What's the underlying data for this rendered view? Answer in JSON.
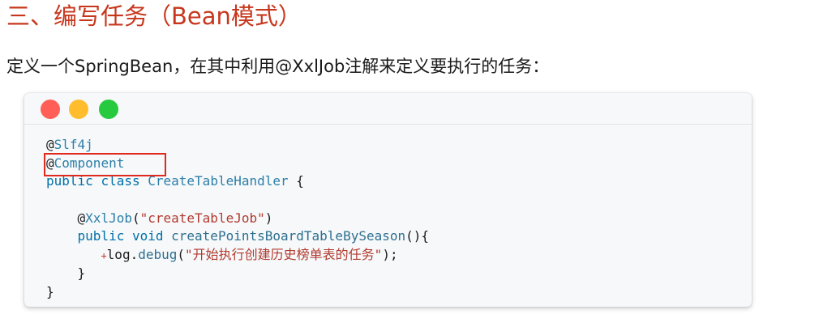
{
  "heading": "三、编写任务（Bean模式）",
  "intro": "定义一个SpringBean，在其中利用@XxlJob注解来定义要执行的任务：",
  "colors": {
    "heading": "#c7371d",
    "highlight_box": "#e02a1e",
    "window_red": "#ff5f56",
    "window_yellow": "#ffbd2e",
    "window_green": "#27c93f"
  },
  "code": {
    "line1": {
      "at": "@",
      "name": "Slf4j"
    },
    "line2": {
      "at": "@",
      "name": "Component"
    },
    "line3": {
      "kw1": "public",
      "kw2": "class",
      "cls": "CreateTableHandler",
      "brace": " {"
    },
    "line5": {
      "at": "@",
      "name": "XxlJob",
      "open": "(",
      "str": "\"createTableJob\"",
      "close": ")"
    },
    "line6": {
      "kw1": "public",
      "kw2": "void",
      "method": "createPointsBoardTableBySeason",
      "rest": "(){"
    },
    "line7": {
      "marker": "+",
      "obj": "log",
      "dot": ".",
      "method": "debug",
      "open": "(",
      "str": "\"开始执行创建历史榜单表的任务\"",
      "close": ");"
    },
    "line8": {
      "brace": "}"
    },
    "line9": {
      "brace": "}"
    }
  }
}
